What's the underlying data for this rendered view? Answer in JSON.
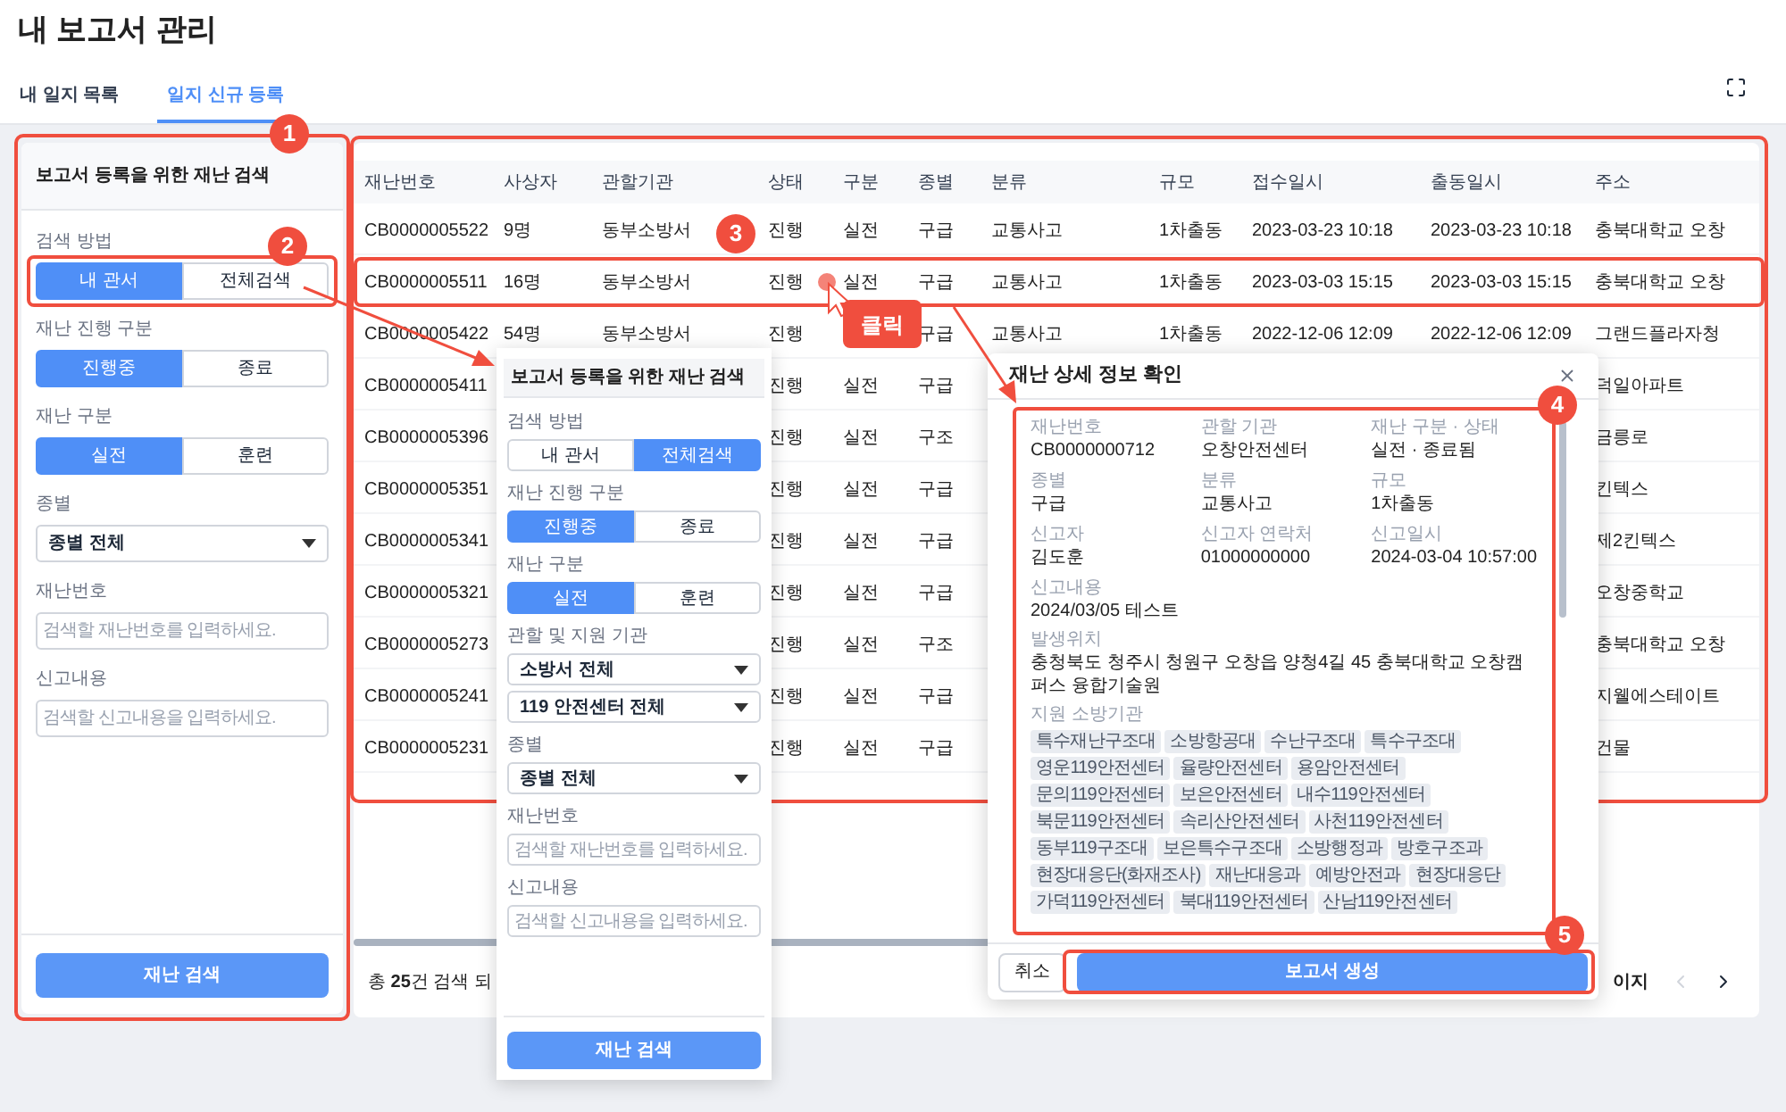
{
  "page": {
    "title": "내 보고서 관리"
  },
  "tabs": [
    {
      "label": "내 일지 목록",
      "selected": false
    },
    {
      "label": "일지 신규 등록",
      "selected": true
    }
  ],
  "search_panel": {
    "title": "보고서 등록을 위한 재난 검색",
    "groups": [
      {
        "kind": "toggle",
        "label": "검색 방법",
        "options": [
          {
            "label": "내 관서",
            "selected": true
          },
          {
            "label": "전체검색",
            "selected": false
          }
        ]
      },
      {
        "kind": "toggle",
        "label": "재난 진행 구분",
        "options": [
          {
            "label": "진행중",
            "selected": true
          },
          {
            "label": "종료",
            "selected": false
          }
        ]
      },
      {
        "kind": "toggle",
        "label": "재난 구분",
        "options": [
          {
            "label": "실전",
            "selected": true
          },
          {
            "label": "훈련",
            "selected": false
          }
        ]
      },
      {
        "kind": "select",
        "label": "종별",
        "values": [
          "종별 전체"
        ]
      },
      {
        "kind": "input",
        "label": "재난번호",
        "placeholder": "검색할 재난번호를 입력하세요."
      },
      {
        "kind": "input",
        "label": "신고내용",
        "placeholder": "검색할 신고내용을 입력하세요."
      }
    ],
    "button": "재난 검색"
  },
  "table": {
    "columns": [
      "재난번호",
      "사상자",
      "관할기관",
      "상태",
      "구분",
      "종별",
      "분류",
      "규모",
      "접수일시",
      "출동일시",
      "주소"
    ],
    "rows": [
      {
        "cells": [
          "CB0000005522",
          "9명",
          "동부소방서",
          "진행",
          "실전",
          "구급",
          "교통사고",
          "1차출동",
          "2023-03-23 10:18",
          "2023-03-23 10:18",
          "충북대학교 오창"
        ]
      },
      {
        "cells": [
          "CB0000005511",
          "16명",
          "동부소방서",
          "진행",
          "실전",
          "구급",
          "교통사고",
          "1차출동",
          "2023-03-03 15:15",
          "2023-03-03 15:15",
          "충북대학교 오창"
        ]
      },
      {
        "cells": [
          "CB0000005422",
          "54명",
          "동부소방서",
          "진행",
          null,
          "구급",
          "교통사고",
          "1차출동",
          "2022-12-06 12:09",
          "2022-12-06 12:09",
          "그랜드플라자청"
        ]
      },
      {
        "cells": [
          "CB0000005411",
          null,
          null,
          "진행",
          "실전",
          "구급",
          null,
          null,
          null,
          null,
          "덕일아파트"
        ]
      },
      {
        "cells": [
          "CB0000005396",
          null,
          null,
          "진행",
          "실전",
          "구조",
          null,
          null,
          null,
          null,
          "금릉로"
        ]
      },
      {
        "cells": [
          "CB0000005351",
          null,
          null,
          "진행",
          "실전",
          "구급",
          null,
          null,
          null,
          null,
          "킨텍스"
        ]
      },
      {
        "cells": [
          "CB0000005341",
          null,
          null,
          "진행",
          "실전",
          "구급",
          null,
          null,
          null,
          null,
          "제2킨텍스"
        ]
      },
      {
        "cells": [
          "CB0000005321",
          null,
          null,
          "진행",
          "실전",
          "구급",
          null,
          null,
          null,
          null,
          "오창중학교"
        ]
      },
      {
        "cells": [
          "CB0000005273",
          null,
          null,
          "진행",
          "실전",
          "구조",
          null,
          null,
          null,
          null,
          "충북대학교 오창"
        ]
      },
      {
        "cells": [
          "CB0000005241",
          null,
          null,
          "진행",
          "실전",
          "구급",
          null,
          null,
          null,
          null,
          "지웰에스테이트"
        ]
      },
      {
        "cells": [
          "CB0000005231",
          null,
          null,
          "진행",
          "실전",
          "구급",
          null,
          null,
          null,
          null,
          "건물"
        ]
      }
    ]
  },
  "footer": {
    "summary": "총 **25**건 검색 되",
    "pagination": "이지"
  },
  "popup_panel": {
    "title": "보고서 등록을 위한 재난 검색",
    "groups": [
      {
        "kind": "toggle",
        "label": "검색 방법",
        "options": [
          {
            "label": "내 관서",
            "selected": false
          },
          {
            "label": "전체검색",
            "selected": true
          }
        ]
      },
      {
        "kind": "toggle",
        "label": "재난 진행 구분",
        "options": [
          {
            "label": "진행중",
            "selected": true
          },
          {
            "label": "종료",
            "selected": false
          }
        ]
      },
      {
        "kind": "toggle",
        "label": "재난 구분",
        "options": [
          {
            "label": "실전",
            "selected": true
          },
          {
            "label": "훈련",
            "selected": false
          }
        ]
      },
      {
        "kind": "select",
        "label": "관할 및 지원 기관",
        "values": [
          "소방서 전체",
          "119 안전센터 전체"
        ]
      },
      {
        "kind": "select",
        "label": "종별",
        "values": [
          "종별 전체"
        ]
      },
      {
        "kind": "input",
        "label": "재난번호",
        "placeholder": "검색할 재난번호를 입력하세요."
      },
      {
        "kind": "input",
        "label": "신고내용",
        "placeholder": "검색할 신고내용을 입력하세요."
      }
    ],
    "button": "재난 검색"
  },
  "detail_modal": {
    "title": "재난 상세 정보 확인",
    "fields": [
      {
        "label": "재난번호",
        "value": "CB0000000712"
      },
      {
        "label": "관할 기관",
        "value": "오창안전센터"
      },
      {
        "label": "재난 구분 · 상태",
        "value": "실전 · 종료됨"
      },
      {
        "label": "종별",
        "value": "구급"
      },
      {
        "label": "분류",
        "value": "교통사고"
      },
      {
        "label": "규모",
        "value": "1차출동"
      },
      {
        "label": "신고자",
        "value": "김도훈"
      },
      {
        "label": "신고자 연락처",
        "value": "01000000000"
      },
      {
        "label": "신고일시",
        "value": "2024-03-04 10:57:00"
      }
    ],
    "wide_fields": [
      {
        "label": "신고내용",
        "value": "2024/03/05 테스트"
      },
      {
        "label": "발생위치",
        "value": "충청북도 청주시 청원구 오창읍 양청4길 45 충북대학교 오창캠퍼스 융합기술원"
      }
    ],
    "agencies": {
      "label": "지원 소방기관",
      "tags": [
        "특수재난구조대",
        "소방항공대",
        "수난구조대",
        "특수구조대",
        "영운119안전센터",
        "율량안전센터",
        "용암안전센터",
        "문의119안전센터",
        "보은안전센터",
        "내수119안전센터",
        "북문119안전센터",
        "속리산안전센터",
        "사천119안전센터",
        "동부119구조대",
        "보은특수구조대",
        "소방행정과",
        "방호구조과",
        "현장대응단(화재조사)",
        "재난대응과",
        "예방안전과",
        "현장대응단",
        "가덕119안전센터",
        "북대119안전센터",
        "산남119안전센터"
      ]
    },
    "cancel": "취소",
    "confirm": "보고서 생성"
  },
  "annotations": {
    "markers": [
      "1",
      "2",
      "3",
      "4",
      "5"
    ],
    "click_label": "클릭"
  }
}
